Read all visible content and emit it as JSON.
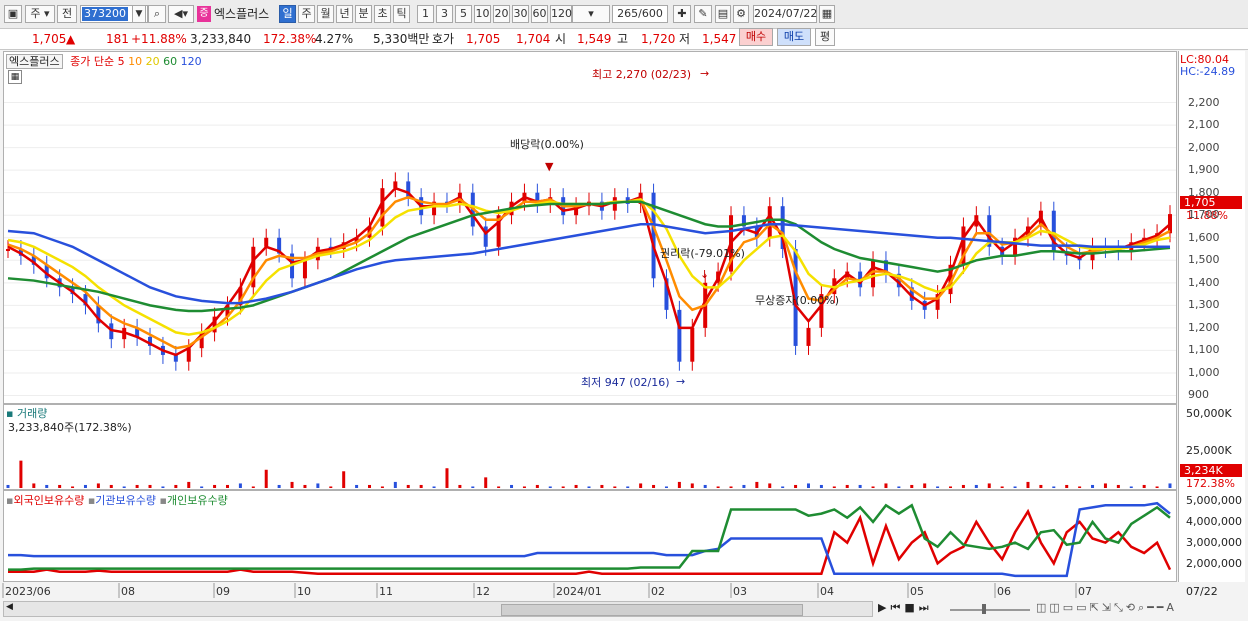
{
  "toolbar": {
    "period_select": "주",
    "prev_label": "전",
    "stock_code": "373200",
    "company_badge": "증",
    "company_name": "엑스플러스",
    "period_tabs": [
      "일",
      "주",
      "월",
      "년",
      "분",
      "초",
      "틱"
    ],
    "active_tab": "일",
    "interval_tabs": [
      "1",
      "3",
      "5",
      "10",
      "20",
      "30",
      "60",
      "120"
    ],
    "count_display": "265/600",
    "date_value": "2024/07/22"
  },
  "quote": {
    "price": "1,705",
    "change_arrow": "▲",
    "change": "181",
    "change_pct": "+11.88%",
    "volume": "3,233,840",
    "volume_ratio": "172.38%",
    "turnover": "4.27%",
    "amount": "5,330백만",
    "ask_label": "호가",
    "ask": "1,705",
    "bid": "1,704",
    "open_label": "시",
    "open": "1,549",
    "high_label": "고",
    "high": "1,720",
    "low_label": "저",
    "low": "1,547",
    "buy_button": "매수",
    "sell_button": "매도",
    "eval_button": "평"
  },
  "price_panel": {
    "stock_name": "엑스플러스",
    "ma_label": "종가 단순",
    "ma_periods": [
      "5",
      "10",
      "20",
      "60",
      "120"
    ],
    "ma_colors": [
      "#e00000",
      "#ff8c00",
      "#f5e100",
      "#1e8c32",
      "#2850dc"
    ],
    "lc_label": "LC:80.04",
    "hc_label": "HC:-24.89",
    "current_price_tag": "1,705",
    "current_pct_tag": "11.88%",
    "high_annotation": "최고 2,270 (02/23)",
    "low_annotation": "최저 947 (02/16)",
    "dividend_annotation": "배당락(0.00%)",
    "rights_annotation": "권리락(-79.01%)",
    "bonus_annotation": "무상증자(0.00%)"
  },
  "volume_panel": {
    "title": "거래량",
    "value_text": "3,233,840주(172.38%)",
    "scale_top": "50,000K",
    "scale_mid": "25,000K",
    "current_tag": "3,234K",
    "current_pct": "172.38%"
  },
  "holdings_panel": {
    "legend": [
      "외국인보유수량",
      "기관보유수량",
      "개인보유수량"
    ],
    "legend_colors": [
      "#e00000",
      "#2850dc",
      "#1e8c32"
    ],
    "scale": [
      "5,000,000",
      "4,000,000",
      "3,000,000",
      "2,000,000"
    ]
  },
  "x_labels": [
    "2023/06",
    "08",
    "09",
    "10",
    "11",
    "12",
    "2024/01",
    "02",
    "03",
    "04",
    "05",
    "06",
    "07"
  ],
  "x_end_label": "07/22",
  "chart_data": {
    "type": "line",
    "title": "",
    "ylabel": "",
    "ylim": [
      880,
      2300
    ],
    "y_ticks": [
      900,
      1000,
      1100,
      1200,
      1300,
      1400,
      1500,
      1600,
      1700,
      1800,
      1900,
      2000,
      2100,
      2200
    ],
    "close_series": [
      1550,
      1520,
      1480,
      1420,
      1380,
      1350,
      1300,
      1220,
      1150,
      1200,
      1160,
      1120,
      1080,
      1050,
      1110,
      1180,
      1250,
      1300,
      1380,
      1560,
      1600,
      1530,
      1420,
      1500,
      1560,
      1550,
      1580,
      1600,
      1650,
      1820,
      1850,
      1780,
      1700,
      1760,
      1750,
      1800,
      1650,
      1560,
      1700,
      1760,
      1800,
      1750,
      1780,
      1700,
      1740,
      1760,
      1720,
      1780,
      1750,
      1800,
      1420,
      1280,
      1050,
      1200,
      1400,
      1450,
      1700,
      1650,
      1600,
      1740,
      1550,
      1120,
      1200,
      1350,
      1420,
      1450,
      1380,
      1500,
      1440,
      1380,
      1320,
      1280,
      1350,
      1480,
      1650,
      1700,
      1560,
      1520,
      1600,
      1650,
      1720,
      1540,
      1520,
      1500,
      1560,
      1550,
      1540,
      1580,
      1600,
      1620,
      1705
    ],
    "series": [
      {
        "name": "5",
        "values": [
          1560,
          1530,
          1490,
          1440,
          1400,
          1360,
          1310,
          1240,
          1190,
          1180,
          1160,
          1130,
          1100,
          1080,
          1110,
          1170,
          1230,
          1300,
          1380,
          1500,
          1560,
          1540,
          1490,
          1500,
          1540,
          1550,
          1570,
          1600,
          1650,
          1760,
          1820,
          1800,
          1740,
          1740,
          1750,
          1780,
          1700,
          1620,
          1670,
          1740,
          1780,
          1760,
          1770,
          1720,
          1730,
          1750,
          1740,
          1760,
          1760,
          1780,
          1560,
          1400,
          1200,
          1200,
          1320,
          1420,
          1580,
          1640,
          1620,
          1700,
          1600,
          1300,
          1230,
          1300,
          1390,
          1440,
          1400,
          1470,
          1450,
          1400,
          1340,
          1300,
          1330,
          1440,
          1600,
          1680,
          1600,
          1540,
          1580,
          1630,
          1690,
          1580,
          1530,
          1510,
          1550,
          1560,
          1550,
          1570,
          1590,
          1610,
          1660
        ]
      },
      {
        "name": "10",
        "values": [
          1570,
          1550,
          1520,
          1480,
          1440,
          1400,
          1360,
          1300,
          1250,
          1220,
          1200,
          1170,
          1140,
          1110,
          1120,
          1160,
          1200,
          1250,
          1320,
          1420,
          1500,
          1520,
          1510,
          1510,
          1530,
          1540,
          1560,
          1580,
          1620,
          1700,
          1760,
          1780,
          1760,
          1750,
          1750,
          1770,
          1730,
          1680,
          1680,
          1720,
          1760,
          1760,
          1770,
          1740,
          1740,
          1750,
          1750,
          1760,
          1760,
          1770,
          1650,
          1500,
          1340,
          1280,
          1300,
          1380,
          1500,
          1580,
          1600,
          1660,
          1620,
          1450,
          1330,
          1320,
          1370,
          1420,
          1410,
          1450,
          1450,
          1420,
          1370,
          1330,
          1330,
          1400,
          1520,
          1620,
          1620,
          1570,
          1580,
          1610,
          1660,
          1610,
          1560,
          1530,
          1540,
          1550,
          1550,
          1560,
          1580,
          1600,
          1630
        ]
      },
      {
        "name": "20",
        "values": [
          1590,
          1580,
          1560,
          1530,
          1500,
          1470,
          1430,
          1380,
          1340,
          1300,
          1270,
          1240,
          1210,
          1180,
          1170,
          1180,
          1200,
          1230,
          1270,
          1340,
          1410,
          1460,
          1480,
          1500,
          1520,
          1530,
          1540,
          1560,
          1590,
          1640,
          1690,
          1720,
          1730,
          1740,
          1740,
          1750,
          1740,
          1720,
          1710,
          1720,
          1740,
          1750,
          1760,
          1750,
          1750,
          1750,
          1750,
          1760,
          1760,
          1770,
          1720,
          1640,
          1520,
          1430,
          1380,
          1380,
          1430,
          1500,
          1550,
          1600,
          1610,
          1540,
          1440,
          1390,
          1380,
          1400,
          1410,
          1430,
          1440,
          1430,
          1410,
          1380,
          1360,
          1380,
          1450,
          1530,
          1580,
          1580,
          1580,
          1600,
          1630,
          1620,
          1590,
          1560,
          1550,
          1550,
          1550,
          1560,
          1570,
          1590,
          1600
        ]
      },
      {
        "name": "60",
        "values": [
          1420,
          1415,
          1410,
          1400,
          1390,
          1380,
          1370,
          1360,
          1345,
          1330,
          1315,
          1300,
          1290,
          1280,
          1275,
          1275,
          1280,
          1285,
          1290,
          1300,
          1320,
          1340,
          1360,
          1380,
          1400,
          1420,
          1450,
          1480,
          1510,
          1540,
          1570,
          1600,
          1620,
          1640,
          1660,
          1680,
          1700,
          1710,
          1720,
          1730,
          1740,
          1745,
          1750,
          1750,
          1750,
          1750,
          1750,
          1755,
          1760,
          1760,
          1740,
          1720,
          1700,
          1680,
          1660,
          1650,
          1650,
          1660,
          1670,
          1680,
          1680,
          1660,
          1620,
          1580,
          1550,
          1530,
          1510,
          1500,
          1490,
          1480,
          1470,
          1460,
          1450,
          1460,
          1480,
          1500,
          1510,
          1520,
          1520,
          1530,
          1540,
          1540,
          1535,
          1530,
          1530,
          1535,
          1540,
          1540,
          1545,
          1550,
          1555
        ]
      },
      {
        "name": "120",
        "values": [
          1630,
          1625,
          1620,
          1600,
          1580,
          1560,
          1530,
          1500,
          1470,
          1440,
          1410,
          1380,
          1360,
          1340,
          1330,
          1320,
          1315,
          1310,
          1310,
          1320,
          1330,
          1345,
          1360,
          1380,
          1400,
          1420,
          1440,
          1460,
          1475,
          1490,
          1500,
          1505,
          1510,
          1515,
          1520,
          1525,
          1530,
          1540,
          1550,
          1560,
          1570,
          1580,
          1590,
          1600,
          1610,
          1620,
          1630,
          1640,
          1650,
          1660,
          1660,
          1650,
          1640,
          1630,
          1620,
          1625,
          1630,
          1640,
          1650,
          1660,
          1660,
          1655,
          1650,
          1645,
          1640,
          1635,
          1630,
          1625,
          1620,
          1615,
          1610,
          1605,
          1600,
          1600,
          1595,
          1590,
          1585,
          1580,
          1575,
          1570,
          1565,
          1565,
          1565,
          1565,
          1560,
          1560,
          1560,
          1560,
          1560,
          1560,
          1560
        ]
      }
    ],
    "volume_series": [
      2,
      18,
      3,
      2,
      2,
      1,
      2,
      3,
      2,
      1,
      2,
      2,
      1,
      2,
      4,
      1,
      2,
      2,
      3,
      1,
      12,
      2,
      4,
      2,
      3,
      1,
      11,
      2,
      2,
      1,
      4,
      2,
      2,
      1,
      13,
      2,
      1,
      7,
      1,
      2,
      1,
      2,
      1,
      1,
      2,
      1,
      2,
      1,
      1,
      3,
      2,
      1,
      4,
      3,
      2,
      1,
      1,
      2,
      4,
      3,
      1,
      2,
      3,
      2,
      1,
      2,
      2,
      1,
      3,
      1,
      2,
      3,
      1,
      1,
      2,
      2,
      3,
      1,
      1,
      4,
      2,
      1,
      2,
      1,
      2,
      3,
      2,
      1,
      2,
      1,
      3
    ],
    "volume_blue_index": [
      62
    ],
    "holdings": {
      "foreign": [
        1.6,
        1.6,
        1.6,
        1.7,
        1.6,
        1.6,
        1.6,
        1.65,
        1.6,
        1.6,
        1.6,
        1.6,
        1.6,
        1.6,
        1.6,
        1.6,
        1.6,
        1.6,
        1.7,
        1.6,
        1.6,
        1.6,
        1.6,
        1.55,
        1.5,
        1.5,
        1.5,
        1.5,
        1.5,
        1.5,
        1.5,
        1.5,
        1.5,
        1.5,
        1.5,
        1.5,
        1.5,
        1.5,
        1.5,
        1.5,
        1.5,
        1.5,
        1.5,
        1.5,
        1.5,
        1.6,
        1.5,
        1.5,
        1.5,
        1.5,
        1.5,
        1.5,
        1.5,
        1.5,
        1.5,
        1.5,
        1.5,
        1.5,
        1.5,
        1.5,
        1.5,
        1.5,
        1.5,
        1.5,
        3.5,
        3.0,
        4.2,
        2.0,
        3.8,
        2.2,
        3.0,
        3.5,
        2.0,
        2.5,
        2.8,
        4.0,
        3.0,
        2.2,
        3.5,
        4.5,
        3.0,
        2.0,
        3.5,
        4.0,
        3.2,
        3.0,
        3.5,
        2.8,
        2.5,
        3.0,
        1.7
      ],
      "institution": [
        2.4,
        2.4,
        2.35,
        2.35,
        2.35,
        2.35,
        2.35,
        2.35,
        2.35,
        2.35,
        2.35,
        2.35,
        2.35,
        2.35,
        2.35,
        2.35,
        2.35,
        2.35,
        2.35,
        2.35,
        2.35,
        2.35,
        2.35,
        2.35,
        2.35,
        2.35,
        2.35,
        2.35,
        2.35,
        2.35,
        2.35,
        2.35,
        2.35,
        2.35,
        2.35,
        2.35,
        2.35,
        2.35,
        2.35,
        2.35,
        2.35,
        2.5,
        2.5,
        2.5,
        2.5,
        2.5,
        2.5,
        2.5,
        2.5,
        2.5,
        2.5,
        2.4,
        2.4,
        2.4,
        2.6,
        2.7,
        3.2,
        3.2,
        3.2,
        3.2,
        3.2,
        3.2,
        3.2,
        3.2,
        1.5,
        1.5,
        1.5,
        1.5,
        1.5,
        1.5,
        1.5,
        1.5,
        1.5,
        1.5,
        1.5,
        1.5,
        1.5,
        1.5,
        1.4,
        1.4,
        1.4,
        1.4,
        1.4,
        4.6,
        4.7,
        4.8,
        4.8,
        4.8,
        4.8,
        4.9,
        4.4
      ],
      "individual": [
        1.7,
        1.7,
        1.75,
        1.75,
        1.75,
        1.75,
        1.75,
        1.75,
        1.75,
        1.75,
        1.75,
        1.75,
        1.75,
        1.75,
        1.75,
        1.75,
        1.75,
        1.75,
        1.75,
        1.75,
        1.75,
        1.75,
        1.75,
        1.75,
        1.75,
        1.75,
        1.75,
        1.75,
        1.75,
        1.75,
        1.75,
        1.75,
        1.75,
        1.75,
        1.75,
        1.75,
        1.75,
        1.75,
        1.75,
        1.75,
        1.75,
        1.75,
        1.75,
        1.75,
        1.75,
        1.75,
        1.75,
        1.75,
        1.75,
        1.8,
        1.8,
        1.8,
        1.8,
        2.6,
        2.6,
        2.6,
        4.6,
        4.6,
        4.6,
        4.6,
        4.6,
        4.6,
        4.3,
        4.4,
        4.6,
        4.2,
        4.7,
        4.0,
        4.8,
        4.4,
        4.8,
        3.2,
        2.8,
        3.5,
        2.9,
        2.8,
        2.7,
        2.8,
        3.0,
        2.7,
        3.5,
        3.6,
        2.9,
        3.0,
        4.0,
        3.2,
        3.0,
        3.9,
        4.3,
        4.7,
        4.2
      ]
    }
  }
}
